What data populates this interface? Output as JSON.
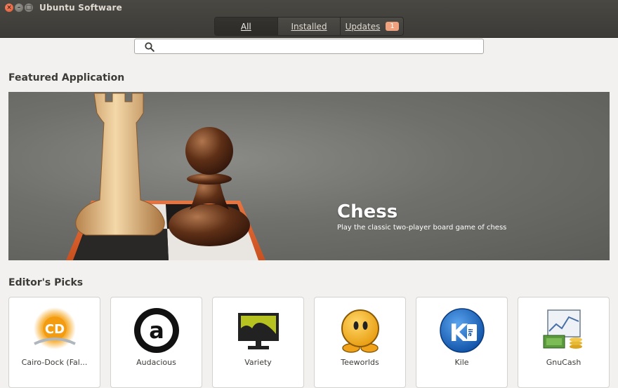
{
  "window": {
    "title": "Ubuntu Software",
    "close_glyph": "×",
    "minimize_glyph": "–",
    "maximize_glyph": "□"
  },
  "tabs": [
    {
      "label": "All",
      "active": true
    },
    {
      "label": "Installed",
      "active": false
    },
    {
      "label": "Updates",
      "active": false,
      "badge": "1"
    }
  ],
  "search": {
    "placeholder": "",
    "value": "",
    "icon": "search-icon"
  },
  "featured": {
    "section_title": "Featured Application",
    "app_name": "Chess",
    "description": "Play the classic two-player board game of chess"
  },
  "editors_picks": {
    "section_title": "Editor's Picks",
    "apps": [
      {
        "name": "Cairo-Dock (Fal...",
        "icon": "cairo-dock-icon"
      },
      {
        "name": "Audacious",
        "icon": "audacious-icon"
      },
      {
        "name": "Variety",
        "icon": "variety-icon"
      },
      {
        "name": "Teeworlds",
        "icon": "teeworlds-icon"
      },
      {
        "name": "Kile",
        "icon": "kile-icon"
      },
      {
        "name": "GnuCash",
        "icon": "gnucash-icon"
      }
    ]
  },
  "colors": {
    "titlebar": "#3c3b37",
    "background": "#f2f1f0",
    "badge": "#f0a27f",
    "close_button": "#e2572c"
  }
}
